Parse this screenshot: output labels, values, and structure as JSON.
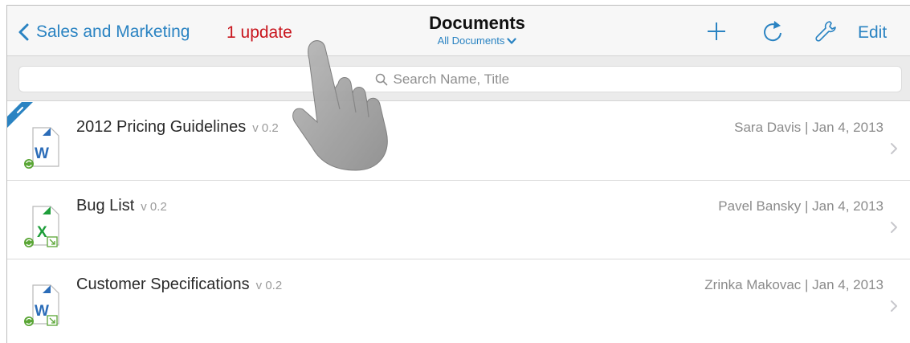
{
  "nav": {
    "back_label": "Sales and Marketing",
    "update_label": "1 update",
    "title": "Documents",
    "filter_label": "All Documents",
    "edit_label": "Edit"
  },
  "search": {
    "placeholder": "Search Name, Title"
  },
  "documents": [
    {
      "name": "2012 Pricing Guidelines",
      "version": "v 0.2",
      "meta": "Sara Davis | Jan 4, 2013",
      "file_type": "word",
      "is_new": true
    },
    {
      "name": "Bug List",
      "version": "v 0.2",
      "meta": "Pavel Bansky | Jan 4, 2013",
      "file_type": "excel",
      "is_new": false
    },
    {
      "name": "Customer Specifications",
      "version": "v 0.2",
      "meta": "Zrinka Makovac | Jan 4, 2013",
      "file_type": "word",
      "is_new": false
    }
  ],
  "icons": {
    "back": "chevron-left-icon",
    "add": "plus-icon",
    "refresh": "refresh-icon",
    "settings": "wrench-icon",
    "search": "search-icon",
    "row_chevron": "chevron-right-icon"
  },
  "colors": {
    "accent": "#2a83c2",
    "update": "#c8151d",
    "word": "#2b6cb8",
    "excel": "#1e9e3a",
    "sync": "#5aa636",
    "ribbon": "#2a83c2"
  }
}
